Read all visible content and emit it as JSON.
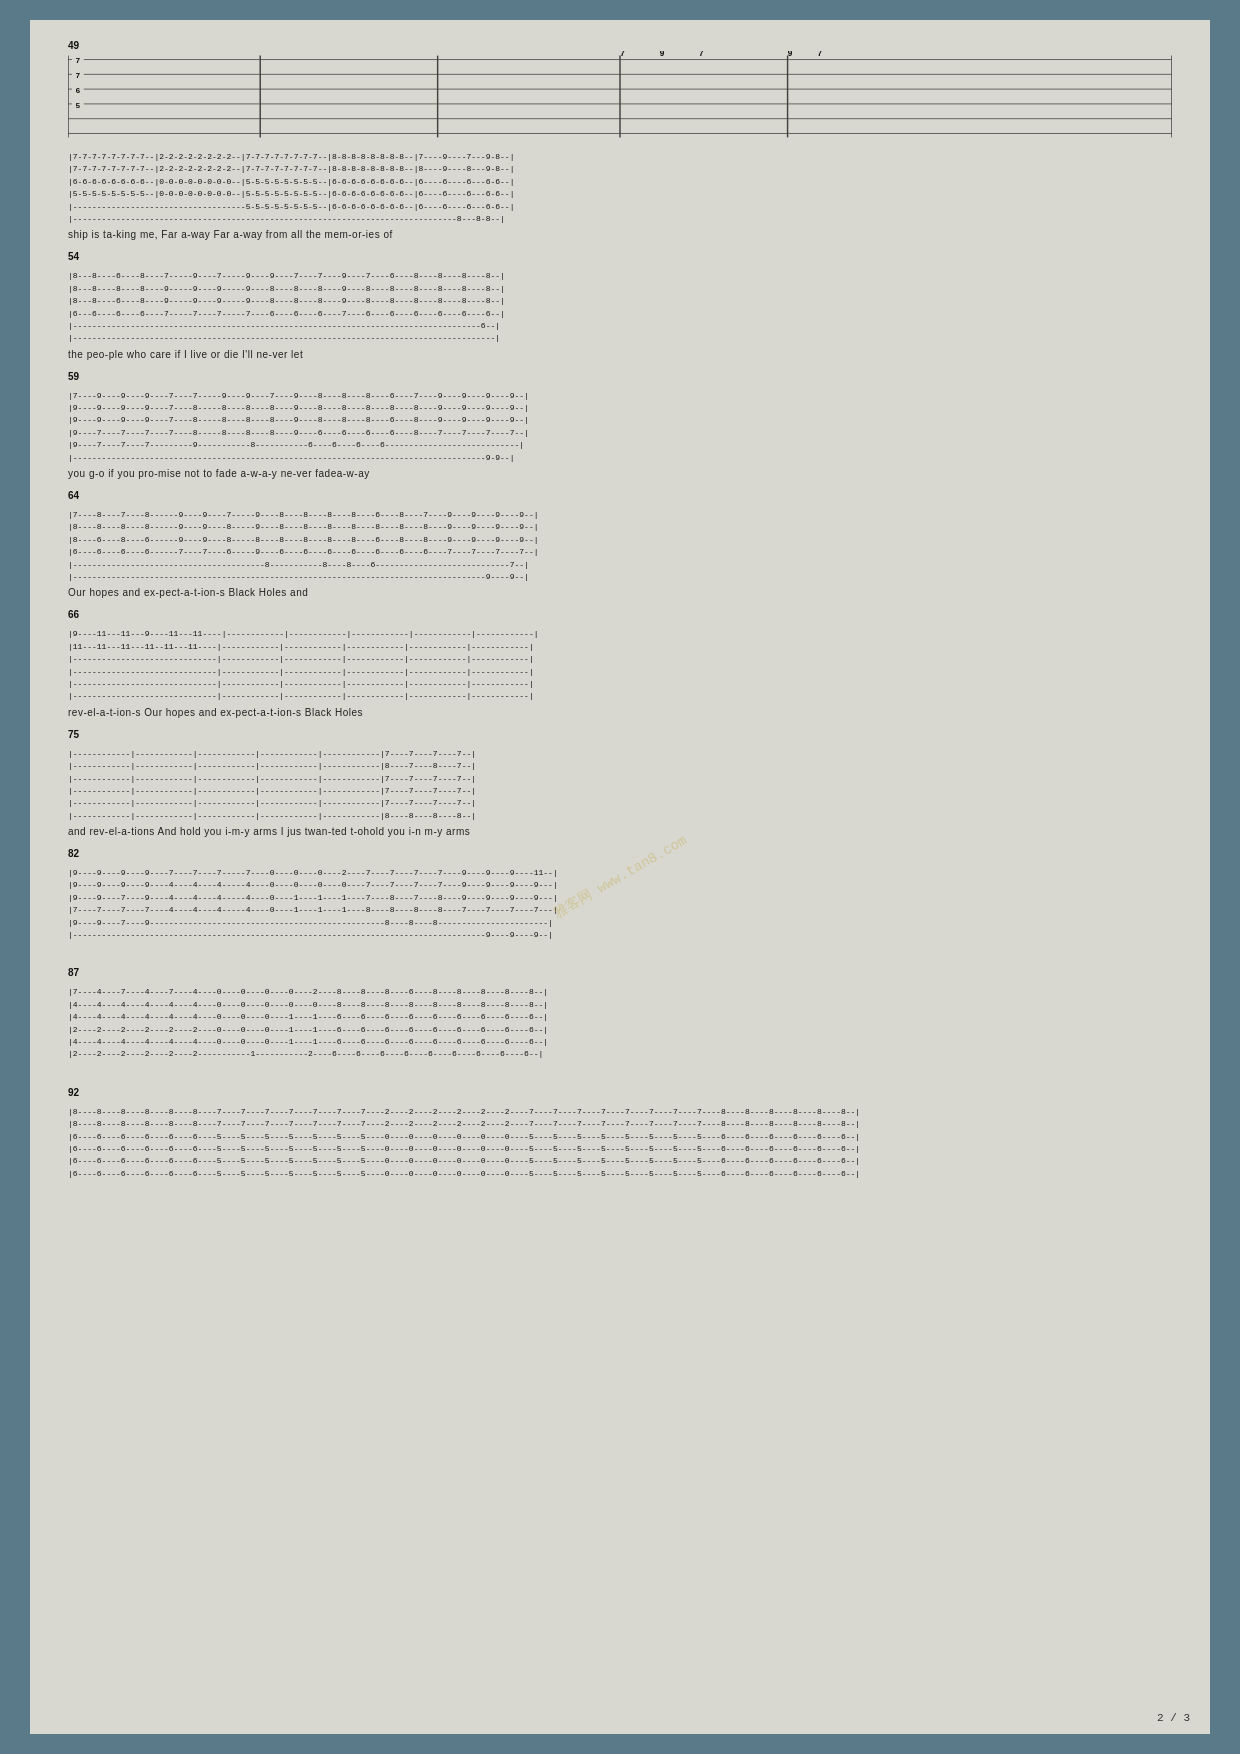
{
  "page": {
    "background_color": "#5a7a8a",
    "paper_color": "#d8d8d0",
    "page_number": "2 / 3",
    "watermark": "雅客网 www.tan8.com"
  },
  "sections": [
    {
      "id": "s49",
      "measure_start": 49,
      "lyrics": "ship        is  ta-king  me, Far    a-way Far    a-way       from all   the                         mem-or-ies of"
    },
    {
      "id": "s54",
      "measure_start": 54,
      "lyrics": "the  peo-ple who  care    if  I    live                  or     die   I'll  ne-ver let"
    },
    {
      "id": "s59",
      "measure_start": 59,
      "lyrics": "you       g-o if    you                        pro-mise not    to    fade a-w-a-y  ne-ver    fadea-w-ay"
    },
    {
      "id": "s64",
      "measure_start": 64,
      "lyrics": "Our                      hopes  and       ex-pect-a-t-ion-s  Black   Holes   and"
    },
    {
      "id": "s66",
      "measure_start": 66,
      "lyrics": "rev-el-a-t-ion-s                          Our    hopes       and  ex-pect-a-t-ion-s  Black  Holes"
    },
    {
      "id": "s75",
      "measure_start": 75,
      "lyrics": "and rev-el-a-tions    And hold you i-m-y arms   I             jus twan-ted t-ohold    you i-n m-y      arms"
    },
    {
      "id": "s82",
      "measure_start": 82,
      "lyrics": ""
    },
    {
      "id": "s87",
      "measure_start": 87,
      "lyrics": ""
    },
    {
      "id": "s92",
      "measure_start": 92,
      "lyrics": ""
    }
  ]
}
